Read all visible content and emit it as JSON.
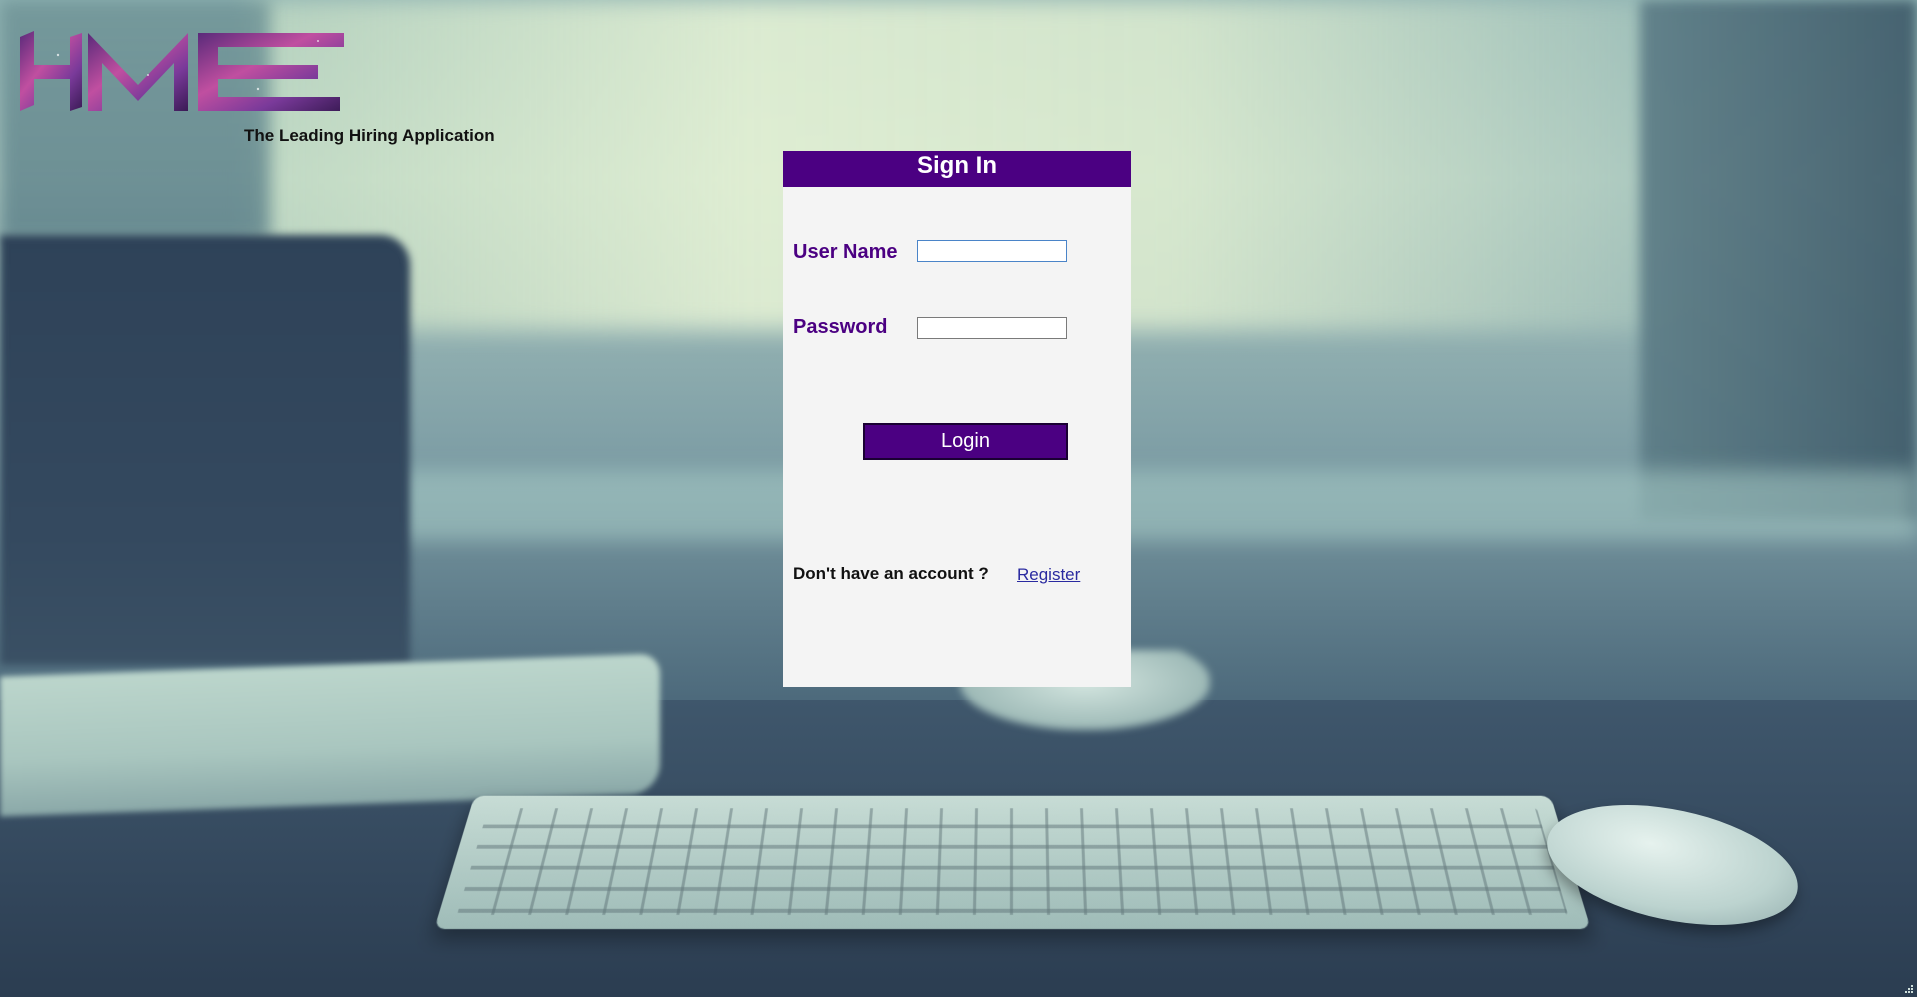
{
  "brand": {
    "logo_text": "HME",
    "tagline": "The Leading Hiring Application"
  },
  "signin": {
    "title": "Sign In",
    "username_label": "User Name",
    "username_value": "",
    "password_label": "Password",
    "password_value": "",
    "login_label": "Login",
    "no_account_text": "Don't have an account ?",
    "register_label": "Register"
  },
  "colors": {
    "brand_purple": "#4b0082",
    "link_blue": "#2a2aa0",
    "panel_bg": "#f4f4f4"
  },
  "icons": {
    "resize_grip": "resize-grip-icon"
  }
}
